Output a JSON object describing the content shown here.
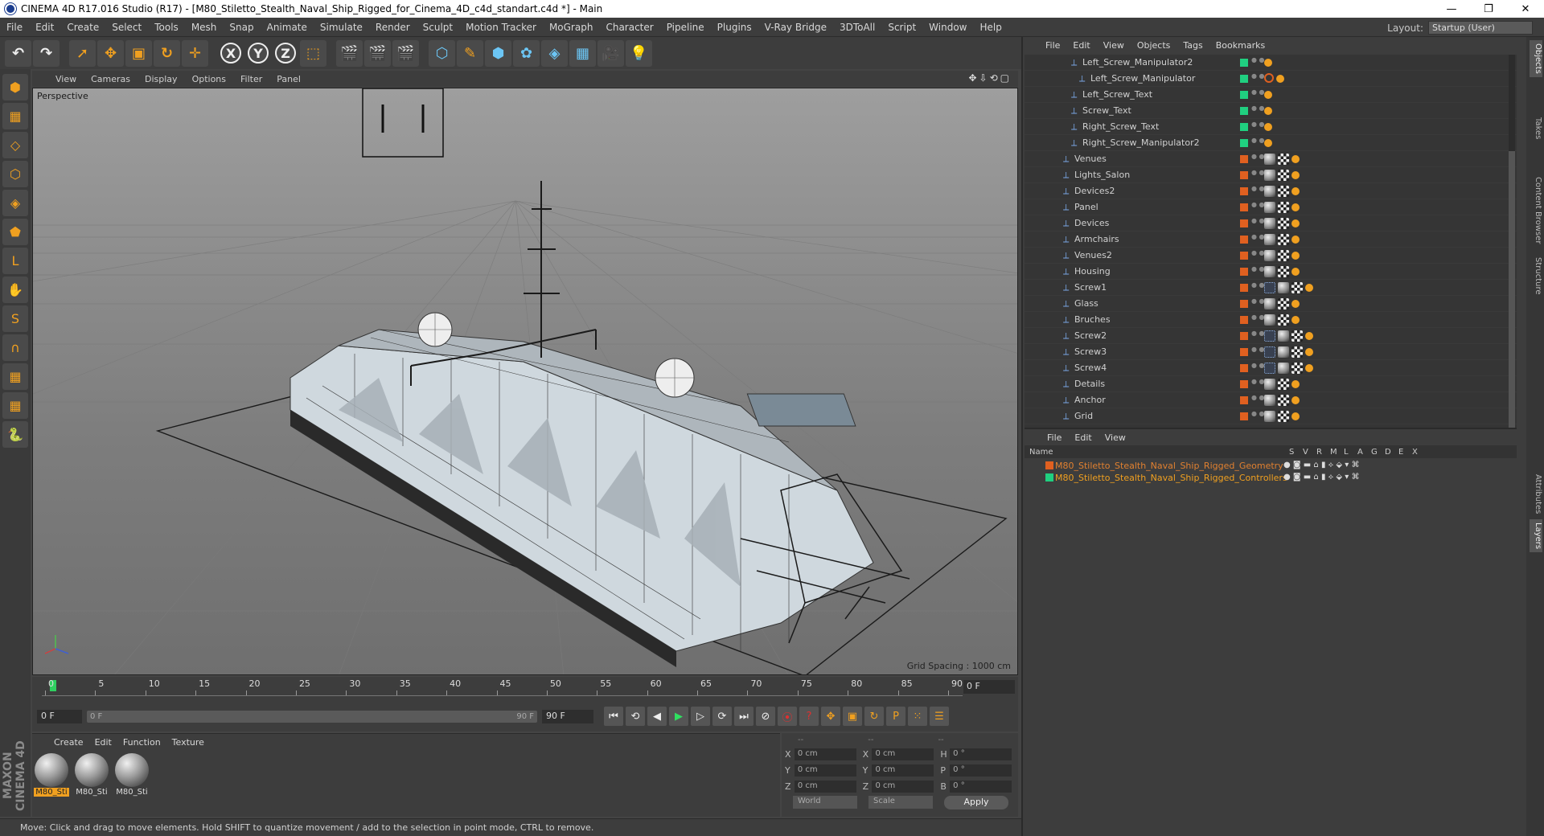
{
  "window": {
    "title": "CINEMA 4D R17.016 Studio (R17) - [M80_Stiletto_Stealth_Naval_Ship_Rigged_for_Cinema_4D_c4d_standart.c4d *] - Main",
    "buttons": [
      "—",
      "❐",
      "✕"
    ]
  },
  "menu": [
    "File",
    "Edit",
    "Create",
    "Select",
    "Tools",
    "Mesh",
    "Snap",
    "Animate",
    "Simulate",
    "Render",
    "Sculpt",
    "Motion Tracker",
    "MoGraph",
    "Character",
    "Pipeline",
    "Plugins",
    "V-Ray Bridge",
    "3DToAll",
    "Script",
    "Window",
    "Help"
  ],
  "layout": {
    "label": "Layout:",
    "value": "Startup (User)"
  },
  "toolbar": [
    {
      "name": "undo-icon",
      "glyph": "↶",
      "style": ""
    },
    {
      "name": "redo-icon",
      "glyph": "↷",
      "style": ""
    },
    {
      "name": "sep",
      "glyph": "",
      "style": "sep"
    },
    {
      "name": "select-arrow-icon",
      "glyph": "➚",
      "style": "orange"
    },
    {
      "name": "move-icon",
      "glyph": "✥",
      "style": "orange"
    },
    {
      "name": "scale-icon",
      "glyph": "▣",
      "style": "orange"
    },
    {
      "name": "rotate-icon",
      "glyph": "↻",
      "style": "orange"
    },
    {
      "name": "transform-icon",
      "glyph": "✛",
      "style": "orange"
    },
    {
      "name": "sep",
      "glyph": "",
      "style": "sep"
    },
    {
      "name": "x-axis-icon",
      "glyph": "X",
      "style": "circ"
    },
    {
      "name": "y-axis-icon",
      "glyph": "Y",
      "style": "circ"
    },
    {
      "name": "z-axis-icon",
      "glyph": "Z",
      "style": "circ"
    },
    {
      "name": "coord-system-icon",
      "glyph": "⬚",
      "style": "orange"
    },
    {
      "name": "sep",
      "glyph": "",
      "style": "sep"
    },
    {
      "name": "render-view-icon",
      "glyph": "🎬",
      "style": ""
    },
    {
      "name": "render-picture-icon",
      "glyph": "🎬",
      "style": ""
    },
    {
      "name": "render-settings-icon",
      "glyph": "🎬",
      "style": ""
    },
    {
      "name": "sep",
      "glyph": "",
      "style": "sep"
    },
    {
      "name": "cube-icon",
      "glyph": "⬡",
      "style": "blue"
    },
    {
      "name": "pen-icon",
      "glyph": "✎",
      "style": "orange"
    },
    {
      "name": "subdivision-icon",
      "glyph": "⬢",
      "style": "blue"
    },
    {
      "name": "cloner-icon",
      "glyph": "✿",
      "style": "blue"
    },
    {
      "name": "deformer-icon",
      "glyph": "◈",
      "style": "blue"
    },
    {
      "name": "floor-icon",
      "glyph": "▦",
      "style": "blue"
    },
    {
      "name": "camera-icon",
      "glyph": "🎥",
      "style": ""
    },
    {
      "name": "light-icon",
      "glyph": "💡",
      "style": ""
    }
  ],
  "left_tools": [
    "model-mode-icon",
    "texture-mode-icon",
    "workplane-icon",
    "points-mode-icon",
    "edges-mode-icon",
    "polygons-mode-icon",
    "axis-icon",
    "tweak-icon",
    "snap-s-icon",
    "magnet-icon",
    "lock-grid-icon",
    "solo-icon",
    "python-icon"
  ],
  "maxon": "MAXON CINEMA 4D",
  "viewport": {
    "menu": [
      "View",
      "Cameras",
      "Display",
      "Options",
      "Filter",
      "Panel"
    ],
    "label": "Perspective",
    "grid_spacing": "Grid Spacing : 1000 cm",
    "nav_icons": "✥⇩⟲▢"
  },
  "timeline": {
    "ticks": [
      "0",
      "5",
      "10",
      "15",
      "20",
      "25",
      "30",
      "35",
      "40",
      "45",
      "50",
      "55",
      "60",
      "65",
      "70",
      "75",
      "80",
      "85",
      "90"
    ],
    "current": "0 F"
  },
  "transport": {
    "start": "0 F",
    "slider_left": "0 F",
    "slider_right": "90 F",
    "end": "90 F",
    "buttons": [
      {
        "name": "go-start-icon",
        "glyph": "⏮",
        "style": ""
      },
      {
        "name": "prev-key-icon",
        "glyph": "⟲",
        "style": ""
      },
      {
        "name": "prev-frame-icon",
        "glyph": "◀",
        "style": ""
      },
      {
        "name": "play-icon",
        "glyph": "▶",
        "style": "green"
      },
      {
        "name": "next-frame-icon",
        "glyph": "▷",
        "style": ""
      },
      {
        "name": "next-key-icon",
        "glyph": "⟳",
        "style": ""
      },
      {
        "name": "go-end-icon",
        "glyph": "⏭",
        "style": ""
      },
      {
        "name": "key-icon",
        "glyph": "⊘",
        "style": ""
      },
      {
        "name": "record-icon",
        "glyph": "⦿",
        "style": "redc"
      },
      {
        "name": "autokey-icon",
        "glyph": "?",
        "style": "redc"
      },
      {
        "name": "move-key-icon",
        "glyph": "✥",
        "style": "orange"
      },
      {
        "name": "scale-key-icon",
        "glyph": "▣",
        "style": "orange"
      },
      {
        "name": "rotate-key-icon",
        "glyph": "↻",
        "style": "orange"
      },
      {
        "name": "param-key-icon",
        "glyph": "P",
        "style": "orange"
      },
      {
        "name": "pla-key-icon",
        "glyph": "⁙",
        "style": "orange"
      },
      {
        "name": "timeline-icon",
        "glyph": "☰",
        "style": "orange"
      }
    ]
  },
  "materials": {
    "menu": [
      "Create",
      "Edit",
      "Function",
      "Texture"
    ],
    "items": [
      {
        "label": "M80_Sti",
        "selected": true
      },
      {
        "label": "M80_Sti",
        "selected": false
      },
      {
        "label": "M80_Sti",
        "selected": false
      }
    ]
  },
  "coords": {
    "header": [
      "--",
      "--",
      "--"
    ],
    "rows": [
      {
        "a1": "X",
        "v1": "0 cm",
        "a2": "X",
        "v2": "0 cm",
        "a3": "H",
        "v3": "0 °"
      },
      {
        "a1": "Y",
        "v1": "0 cm",
        "a2": "Y",
        "v2": "0 cm",
        "a3": "P",
        "v3": "0 °"
      },
      {
        "a1": "Z",
        "v1": "0 cm",
        "a2": "Z",
        "v2": "0 cm",
        "a3": "B",
        "v3": "0 °"
      }
    ],
    "world": "World",
    "scale": "Scale",
    "apply": "Apply"
  },
  "status": "Move: Click and drag to move elements. Hold SHIFT to quantize movement / add to the selection in point mode, CTRL to remove.",
  "objects": {
    "menu": [
      "File",
      "Edit",
      "View",
      "Objects",
      "Tags",
      "Bookmarks"
    ],
    "rows": [
      {
        "name": "Left_Screw_Manipulator2",
        "indent": 3,
        "color": "#20d080",
        "tags": [
          "ik"
        ]
      },
      {
        "name": "Left_Screw_Manipulator",
        "indent": 4,
        "color": "#20d080",
        "tags": [
          "no",
          "ik"
        ]
      },
      {
        "name": "Left_Screw_Text",
        "indent": 3,
        "color": "#20d080",
        "tags": [
          "ik"
        ]
      },
      {
        "name": "Screw_Text",
        "indent": 3,
        "color": "#20d080",
        "tags": [
          "ik"
        ]
      },
      {
        "name": "Right_Screw_Text",
        "indent": 3,
        "color": "#20d080",
        "tags": [
          "ik"
        ]
      },
      {
        "name": "Right_Screw_Manipulator2",
        "indent": 3,
        "color": "#20d080",
        "tags": [
          "ik"
        ]
      },
      {
        "name": "Venues",
        "indent": 2,
        "color": "#e06020",
        "tags": [
          "sph",
          "chk",
          "ik"
        ]
      },
      {
        "name": "Lights_Salon",
        "indent": 2,
        "color": "#e06020",
        "tags": [
          "sph",
          "chk",
          "ik"
        ]
      },
      {
        "name": "Devices2",
        "indent": 2,
        "color": "#e06020",
        "tags": [
          "sph",
          "chk",
          "ik"
        ]
      },
      {
        "name": "Panel",
        "indent": 2,
        "color": "#e06020",
        "tags": [
          "sph",
          "chk",
          "ik"
        ]
      },
      {
        "name": "Devices",
        "indent": 2,
        "color": "#e06020",
        "tags": [
          "sph",
          "chk",
          "ik"
        ]
      },
      {
        "name": "Armchairs",
        "indent": 2,
        "color": "#e06020",
        "tags": [
          "sph",
          "chk",
          "ik"
        ]
      },
      {
        "name": "Venues2",
        "indent": 2,
        "color": "#e06020",
        "tags": [
          "sph",
          "chk",
          "ik"
        ]
      },
      {
        "name": "Housing",
        "indent": 2,
        "color": "#e06020",
        "tags": [
          "sph",
          "chk",
          "ik"
        ]
      },
      {
        "name": "Screw1",
        "indent": 2,
        "color": "#e06020",
        "tags": [
          "blu",
          "sph",
          "chk",
          "ik"
        ]
      },
      {
        "name": "Glass",
        "indent": 2,
        "color": "#e06020",
        "tags": [
          "sph",
          "chk",
          "ik"
        ]
      },
      {
        "name": "Bruches",
        "indent": 2,
        "color": "#e06020",
        "tags": [
          "sph",
          "chk",
          "ik"
        ]
      },
      {
        "name": "Screw2",
        "indent": 2,
        "color": "#e06020",
        "tags": [
          "blu",
          "sph",
          "chk",
          "ik"
        ]
      },
      {
        "name": "Screw3",
        "indent": 2,
        "color": "#e06020",
        "tags": [
          "blu",
          "sph",
          "chk",
          "ik"
        ]
      },
      {
        "name": "Screw4",
        "indent": 2,
        "color": "#e06020",
        "tags": [
          "blu",
          "sph",
          "chk",
          "ik"
        ]
      },
      {
        "name": "Details",
        "indent": 2,
        "color": "#e06020",
        "tags": [
          "sph",
          "chk",
          "ik"
        ]
      },
      {
        "name": "Anchor",
        "indent": 2,
        "color": "#e06020",
        "tags": [
          "sph",
          "chk",
          "ik"
        ]
      },
      {
        "name": "Grid",
        "indent": 2,
        "color": "#e06020",
        "tags": [
          "sph",
          "chk",
          "ik"
        ]
      }
    ]
  },
  "layers": {
    "menu": [
      "File",
      "Edit",
      "View"
    ],
    "columns": [
      "Name",
      "S",
      "V",
      "R",
      "M",
      "L",
      "A",
      "G",
      "D",
      "E",
      "X"
    ],
    "rows": [
      {
        "name": "M80_Stiletto_Stealth_Naval_Ship_Rigged_Geometry",
        "color": "#e06020",
        "text": "#e08030"
      },
      {
        "name": "M80_Stiletto_Stealth_Naval_Ship_Rigged_Controllers",
        "color": "#20d080",
        "text": "#f0a020"
      }
    ]
  },
  "sidetabs": [
    "Objects",
    "Takes",
    "Content Browser",
    "Structure",
    "Attributes",
    "Layers"
  ]
}
